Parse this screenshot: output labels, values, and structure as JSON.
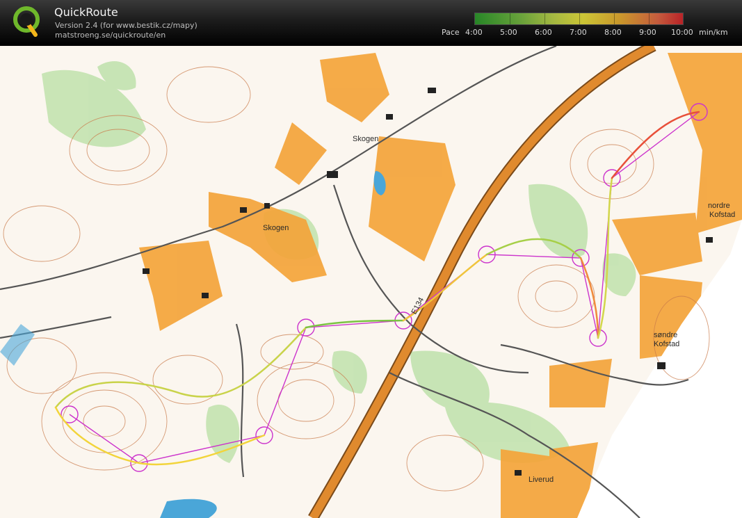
{
  "app": {
    "title": "QuickRoute",
    "version": "Version 2.4  (for www.bestik.cz/mapy)",
    "url": "matstroeng.se/quickroute/en"
  },
  "legend": {
    "label": "Pace",
    "ticks": [
      "4:00",
      "5:00",
      "6:00",
      "7:00",
      "8:00",
      "9:00",
      "10:00"
    ],
    "unit": "min/km",
    "gradient_colors": [
      "#2aa12a",
      "#7bc342",
      "#f7ef3c",
      "#f5b52f",
      "#e0242a"
    ]
  },
  "map": {
    "labels": {
      "skogen1": "Skogen",
      "skogen2": "Skogen",
      "road": "E134",
      "nordre_line1": "nordre",
      "nordre_line2": "Kofstad",
      "sondre_line1": "søndre",
      "sondre_line2": "Kofstad",
      "liverud": "Liverud"
    },
    "colors": {
      "open_land": "#f4a43a",
      "forest_green": "#b9dfa5",
      "contour": "#c2703e",
      "road": "#d17a2a",
      "course": "#cc33cc",
      "route_track": "#d2d64a",
      "water": "#4aa6d8"
    }
  }
}
